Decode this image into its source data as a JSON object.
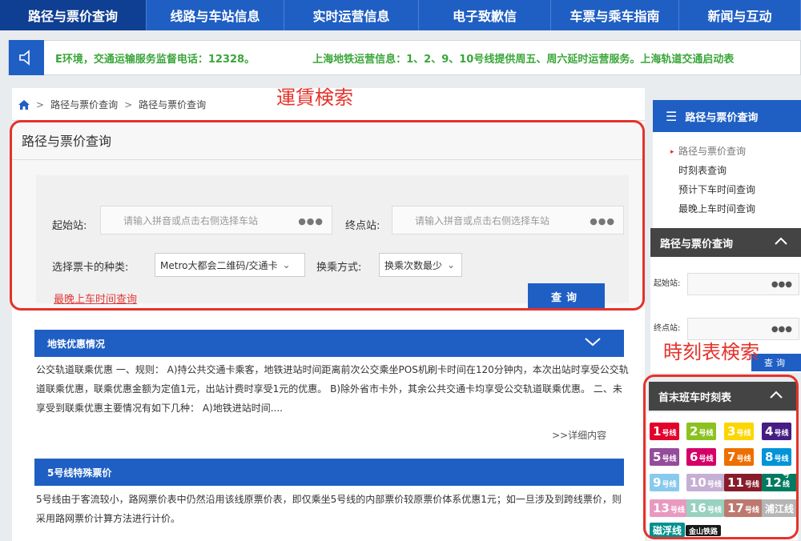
{
  "nav": {
    "tabs": [
      {
        "label": "路径与票价查询"
      },
      {
        "label": "线路与车站信息"
      },
      {
        "label": "实时运营信息"
      },
      {
        "label": "电子致歉信"
      },
      {
        "label": "车票与乘车指南"
      },
      {
        "label": "新闻与互动"
      }
    ]
  },
  "ticker": {
    "message1": "E环境，交通运输服务监督电话：12328。",
    "message2": "上海地铁运营信息：1、2、9、10号线提供周五、周六延时运营服务。上海轨道交通启动表"
  },
  "breadcrumb": {
    "items": [
      "路径与票价查询",
      "路径与票价查询"
    ]
  },
  "search": {
    "title": "路径与票价查询",
    "start_label": "起始站:",
    "start_placeholder": "请输入拼音或点击右侧选择车站",
    "end_label": "终点站:",
    "end_placeholder": "请输入拼音或点击右侧选择车站",
    "dots": "●●●",
    "card_label": "选择票卡的种类:",
    "card_value": "Metro大都会二维码/交通卡",
    "transfer_label": "换乘方式:",
    "transfer_value": "换乘次数最少",
    "latest_link": "最晚上车时间查询",
    "query_button": "查询"
  },
  "annotations": {
    "fare_search": "運賃検索",
    "timetable_search": "時刻表検索"
  },
  "discount": {
    "title": "地铁优惠情况",
    "text": "公交轨道联乘优惠 一、规则： A)持公共交通卡乘客，地铁进站时间距离前次公交乘坐POS机刷卡时间在120分钟内，本次出站时享受公交轨道联乘优惠，联乘优惠金额为定值1元，出站计费时享受1元的优惠。 B)除外省市卡外，其余公共交通卡均享受公交轨道联乘优惠。 二、未享受到联乘优惠主要情况有如下几种： A)地铁进站时间....",
    "more": ">>详细内容"
  },
  "line5": {
    "title": "5号线特殊票价",
    "text": "5号线由于客流较小，路网票价表中仍然沿用该线原票价表，即仅乘坐5号线的内部票价较原票价体系优惠1元；如一旦涉及到跨线票价，则采用路网票价计算方法进行计价。"
  },
  "sidebar": {
    "title": "路径与票价查询",
    "menu": [
      "路径与票价查询",
      "时刻表查询",
      "预计下车时间查询",
      "最晚上车时间查询"
    ],
    "form_title": "路径与票价查询",
    "start_label": "起始站:",
    "end_label": "终点站:",
    "dots": "●●●",
    "query_button": "查询",
    "timetable_title": "首末班车时刻表"
  },
  "lines": {
    "suffix": "号线",
    "items": [
      {
        "num": "1",
        "color": "#e3002b"
      },
      {
        "num": "2",
        "color": "#8cc220"
      },
      {
        "num": "3",
        "color": "#fcd600"
      },
      {
        "num": "4",
        "color": "#461d84"
      },
      {
        "num": "5",
        "color": "#944d9a"
      },
      {
        "num": "6",
        "color": "#d40068"
      },
      {
        "num": "7",
        "color": "#ed6f00"
      },
      {
        "num": "8",
        "color": "#0094d8"
      },
      {
        "num": "9",
        "color": "#87caed"
      },
      {
        "num": "10",
        "color": "#c6afd4"
      },
      {
        "num": "11",
        "color": "#871c2b"
      },
      {
        "num": "12",
        "color": "#007a60"
      },
      {
        "num": "13",
        "color": "#e999c0"
      },
      {
        "num": "16",
        "color": "#98d1c0"
      },
      {
        "num": "17",
        "color": "#bc796f"
      }
    ],
    "pujiang": {
      "label": "浦江线",
      "color": "#b5b5b6"
    },
    "maglev": {
      "label": "磁浮线",
      "color": "#009090"
    },
    "jinshan": {
      "label": "金山铁路",
      "color": "#1a1a1a"
    }
  }
}
